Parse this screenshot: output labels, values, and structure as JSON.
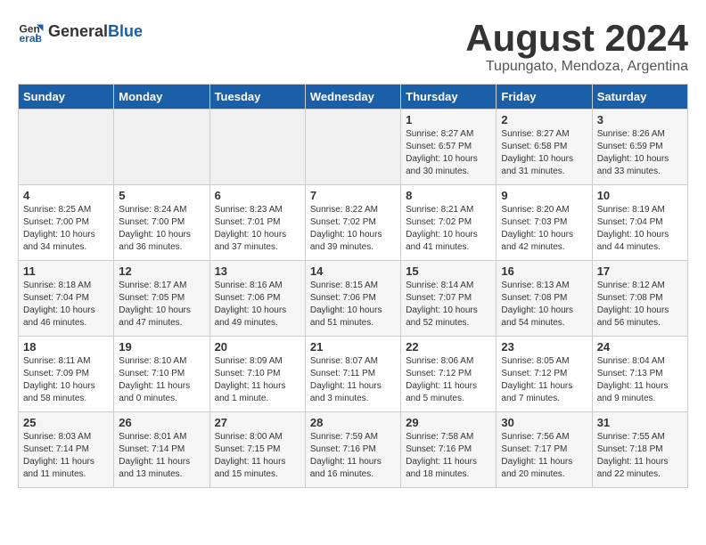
{
  "header": {
    "logo_general": "General",
    "logo_blue": "Blue",
    "month_year": "August 2024",
    "location": "Tupungato, Mendoza, Argentina"
  },
  "weekdays": [
    "Sunday",
    "Monday",
    "Tuesday",
    "Wednesday",
    "Thursday",
    "Friday",
    "Saturday"
  ],
  "weeks": [
    [
      {
        "day": "",
        "empty": true
      },
      {
        "day": "",
        "empty": true
      },
      {
        "day": "",
        "empty": true
      },
      {
        "day": "",
        "empty": true
      },
      {
        "day": "1",
        "sunrise": "8:27 AM",
        "sunset": "6:57 PM",
        "daylight": "10 hours and 30 minutes."
      },
      {
        "day": "2",
        "sunrise": "8:27 AM",
        "sunset": "6:58 PM",
        "daylight": "10 hours and 31 minutes."
      },
      {
        "day": "3",
        "sunrise": "8:26 AM",
        "sunset": "6:59 PM",
        "daylight": "10 hours and 33 minutes."
      }
    ],
    [
      {
        "day": "4",
        "sunrise": "8:25 AM",
        "sunset": "7:00 PM",
        "daylight": "10 hours and 34 minutes."
      },
      {
        "day": "5",
        "sunrise": "8:24 AM",
        "sunset": "7:00 PM",
        "daylight": "10 hours and 36 minutes."
      },
      {
        "day": "6",
        "sunrise": "8:23 AM",
        "sunset": "7:01 PM",
        "daylight": "10 hours and 37 minutes."
      },
      {
        "day": "7",
        "sunrise": "8:22 AM",
        "sunset": "7:02 PM",
        "daylight": "10 hours and 39 minutes."
      },
      {
        "day": "8",
        "sunrise": "8:21 AM",
        "sunset": "7:02 PM",
        "daylight": "10 hours and 41 minutes."
      },
      {
        "day": "9",
        "sunrise": "8:20 AM",
        "sunset": "7:03 PM",
        "daylight": "10 hours and 42 minutes."
      },
      {
        "day": "10",
        "sunrise": "8:19 AM",
        "sunset": "7:04 PM",
        "daylight": "10 hours and 44 minutes."
      }
    ],
    [
      {
        "day": "11",
        "sunrise": "8:18 AM",
        "sunset": "7:04 PM",
        "daylight": "10 hours and 46 minutes."
      },
      {
        "day": "12",
        "sunrise": "8:17 AM",
        "sunset": "7:05 PM",
        "daylight": "10 hours and 47 minutes."
      },
      {
        "day": "13",
        "sunrise": "8:16 AM",
        "sunset": "7:06 PM",
        "daylight": "10 hours and 49 minutes."
      },
      {
        "day": "14",
        "sunrise": "8:15 AM",
        "sunset": "7:06 PM",
        "daylight": "10 hours and 51 minutes."
      },
      {
        "day": "15",
        "sunrise": "8:14 AM",
        "sunset": "7:07 PM",
        "daylight": "10 hours and 52 minutes."
      },
      {
        "day": "16",
        "sunrise": "8:13 AM",
        "sunset": "7:08 PM",
        "daylight": "10 hours and 54 minutes."
      },
      {
        "day": "17",
        "sunrise": "8:12 AM",
        "sunset": "7:08 PM",
        "daylight": "10 hours and 56 minutes."
      }
    ],
    [
      {
        "day": "18",
        "sunrise": "8:11 AM",
        "sunset": "7:09 PM",
        "daylight": "10 hours and 58 minutes."
      },
      {
        "day": "19",
        "sunrise": "8:10 AM",
        "sunset": "7:10 PM",
        "daylight": "11 hours and 0 minutes."
      },
      {
        "day": "20",
        "sunrise": "8:09 AM",
        "sunset": "7:10 PM",
        "daylight": "11 hours and 1 minute."
      },
      {
        "day": "21",
        "sunrise": "8:07 AM",
        "sunset": "7:11 PM",
        "daylight": "11 hours and 3 minutes."
      },
      {
        "day": "22",
        "sunrise": "8:06 AM",
        "sunset": "7:12 PM",
        "daylight": "11 hours and 5 minutes."
      },
      {
        "day": "23",
        "sunrise": "8:05 AM",
        "sunset": "7:12 PM",
        "daylight": "11 hours and 7 minutes."
      },
      {
        "day": "24",
        "sunrise": "8:04 AM",
        "sunset": "7:13 PM",
        "daylight": "11 hours and 9 minutes."
      }
    ],
    [
      {
        "day": "25",
        "sunrise": "8:03 AM",
        "sunset": "7:14 PM",
        "daylight": "11 hours and 11 minutes."
      },
      {
        "day": "26",
        "sunrise": "8:01 AM",
        "sunset": "7:14 PM",
        "daylight": "11 hours and 13 minutes."
      },
      {
        "day": "27",
        "sunrise": "8:00 AM",
        "sunset": "7:15 PM",
        "daylight": "11 hours and 15 minutes."
      },
      {
        "day": "28",
        "sunrise": "7:59 AM",
        "sunset": "7:16 PM",
        "daylight": "11 hours and 16 minutes."
      },
      {
        "day": "29",
        "sunrise": "7:58 AM",
        "sunset": "7:16 PM",
        "daylight": "11 hours and 18 minutes."
      },
      {
        "day": "30",
        "sunrise": "7:56 AM",
        "sunset": "7:17 PM",
        "daylight": "11 hours and 20 minutes."
      },
      {
        "day": "31",
        "sunrise": "7:55 AM",
        "sunset": "7:18 PM",
        "daylight": "11 hours and 22 minutes."
      }
    ]
  ]
}
